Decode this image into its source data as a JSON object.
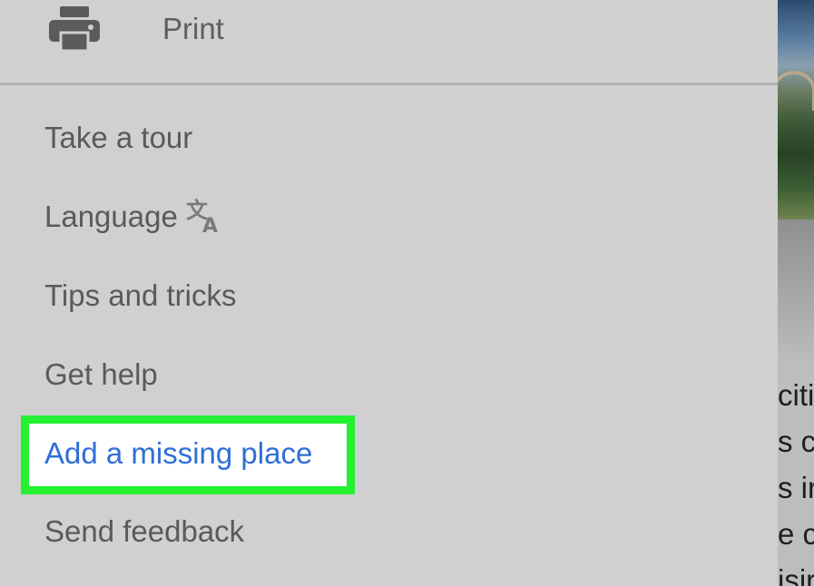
{
  "menu": {
    "print_label": "Print",
    "items": [
      {
        "label": "Take a tour"
      },
      {
        "label": "Language"
      },
      {
        "label": "Tips and tricks"
      },
      {
        "label": "Get help"
      },
      {
        "label": "Add a missing place"
      },
      {
        "label": "Send feedback"
      }
    ],
    "highlighted_item": "Add a missing place"
  },
  "background": {
    "text_fragments": [
      "citi",
      "s c",
      "s ir",
      "e c",
      "isir"
    ]
  },
  "icons": {
    "print": "printer-icon",
    "language": "translate-icon"
  },
  "colors": {
    "drawer_bg": "#d0d0d0",
    "item_text": "#5a5a5a",
    "link_blue": "#2e6fd6",
    "highlight_border": "#22f031"
  }
}
